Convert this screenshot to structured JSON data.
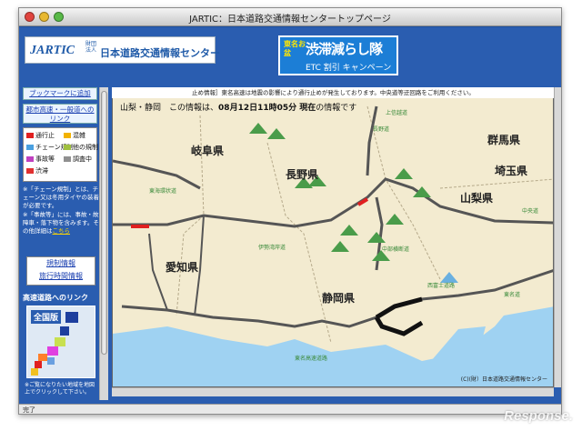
{
  "window": {
    "title": "JARTIC：日本道路交通情報センタートップページ",
    "status": "完了"
  },
  "header": {
    "logo_jartic": "JARTIC",
    "logo_sub": "財団法人",
    "logo_name": "日本道路交通情報センター",
    "campaign_top": "東名お盆",
    "campaign_main": "渋滞減らし隊",
    "campaign_sub": "ETC 割引 キャンペーン"
  },
  "sidebar": {
    "bookmark": "ブックマークに追加",
    "link_toshi": "都市高速・一般道へのリンク",
    "legend": [
      {
        "label": "通行止",
        "color": "#e02020"
      },
      {
        "label": "混雑",
        "color": "#f2b200"
      },
      {
        "label": "チェーン規制",
        "color": "#4aa0e0"
      },
      {
        "label": "他の規制",
        "color": "#a0c040"
      },
      {
        "label": "事故等",
        "color": "#c040c0"
      },
      {
        "label": "調査中",
        "color": "#909090"
      },
      {
        "label": "渋滞",
        "color": "#e03030"
      }
    ],
    "note1": "※「チェーン規制」とは、チェーン又は冬用タイヤの装着が必要です。",
    "note2": "※「事故等」には、事故・故障車・落下物を含みます。その他詳細は",
    "note2_link": "こちら",
    "link_regulation": "規制情報",
    "link_time": "旅行時間情報",
    "hw_head": "高速道路へのリンク",
    "zenkoku": "全国版",
    "mini_foot": "※ご覧になりたい地域を地図上でクリックして下さい。"
  },
  "map": {
    "ticker": "止め情報］東名高速は地震の影響により通行止めが発生しております。中央道等迂回路をご利用ください。",
    "area": "山梨・静岡",
    "info_label": "この情報は、",
    "info_time": "08月12日11時05分 現在",
    "info_suffix": "の情報です",
    "prefectures": [
      "岐阜県",
      "長野県",
      "群馬県",
      "埼玉県",
      "山梨県",
      "愛知県",
      "静岡県"
    ],
    "road_labels": [
      "東海環状道",
      "中央道",
      "東名高速道路",
      "伊勢湾岸道",
      "西富士道路",
      "中部横断道",
      "長野道",
      "上信越道",
      "東名道"
    ],
    "copyright": "(C)(財）日本道路交通情報センター"
  },
  "watermark": "Response."
}
